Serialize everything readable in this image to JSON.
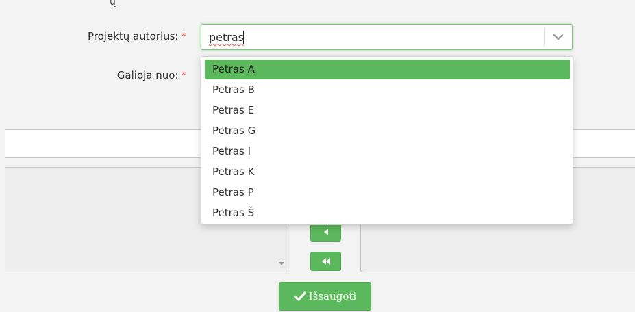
{
  "form": {
    "author_label": "Projektų autorius:",
    "valid_from_label": "Galioja nuo:",
    "required_mark": "*",
    "author_input_value": "petras"
  },
  "dropdown": {
    "options": [
      "Petras A",
      "Petras B",
      "Petras E",
      "Petras G",
      "Petras I",
      "Petras K",
      "Petras P",
      "Petras Š"
    ],
    "selected_index": 0
  },
  "transfer": {
    "move_left_icon": "caret-left-icon",
    "move_all_left_icon": "double-chevron-left-icon"
  },
  "actions": {
    "save_label": "Išsaugoti",
    "save_icon": "check-icon"
  },
  "colors": {
    "accent_green": "#5cb85c",
    "required_red": "#d9534f"
  }
}
